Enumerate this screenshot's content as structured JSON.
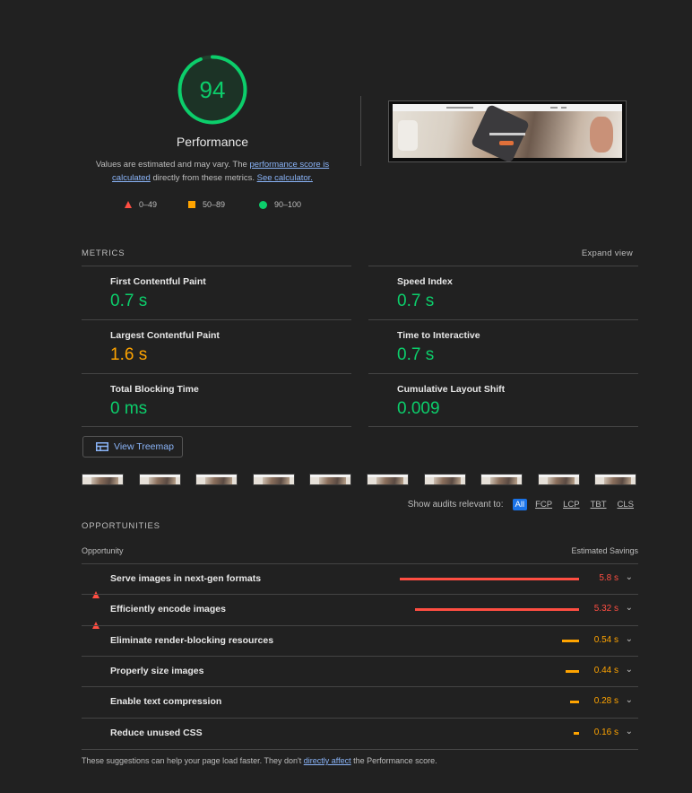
{
  "summary": {
    "score": "94",
    "score_color": "#0cce6b",
    "score_fraction": 0.94,
    "title": "Performance",
    "desc_prefix": "Values are estimated and may vary. The ",
    "desc_link1": "performance score is calculated",
    "desc_mid": " directly from these metrics. ",
    "desc_link2": "See calculator."
  },
  "legend": [
    {
      "icon": "fail-triangle",
      "range": "0–49"
    },
    {
      "icon": "average-square",
      "range": "50–89"
    },
    {
      "icon": "pass-circle",
      "range": "90–100"
    }
  ],
  "metrics_section": {
    "header": "METRICS",
    "expand": "Expand view"
  },
  "metrics": [
    {
      "name": "First Contentful Paint",
      "value": "0.7 s",
      "rating": "pass"
    },
    {
      "name": "Speed Index",
      "value": "0.7 s",
      "rating": "pass"
    },
    {
      "name": "Largest Contentful Paint",
      "value": "1.6 s",
      "rating": "average"
    },
    {
      "name": "Time to Interactive",
      "value": "0.7 s",
      "rating": "pass"
    },
    {
      "name": "Total Blocking Time",
      "value": "0 ms",
      "rating": "pass"
    },
    {
      "name": "Cumulative Layout Shift",
      "value": "0.009",
      "rating": "pass"
    }
  ],
  "treemap": {
    "label": "View Treemap",
    "icon": "treemap-icon"
  },
  "filter": {
    "label": "Show audits relevant to:",
    "chips": [
      "All",
      "FCP",
      "LCP",
      "TBT",
      "CLS"
    ],
    "active": "All"
  },
  "opportunities": {
    "header": "OPPORTUNITIES",
    "col_opportunity": "Opportunity",
    "col_savings": "Estimated Savings",
    "items": [
      {
        "title": "Serve images in next-gen formats",
        "savings": "5.8 s",
        "seconds": 5.8,
        "rating": "fail"
      },
      {
        "title": "Efficiently encode images",
        "savings": "5.32 s",
        "seconds": 5.32,
        "rating": "fail"
      },
      {
        "title": "Eliminate render-blocking resources",
        "savings": "0.54 s",
        "seconds": 0.54,
        "rating": "average"
      },
      {
        "title": "Properly size images",
        "savings": "0.44 s",
        "seconds": 0.44,
        "rating": "average"
      },
      {
        "title": "Enable text compression",
        "savings": "0.28 s",
        "seconds": 0.28,
        "rating": "average"
      },
      {
        "title": "Reduce unused CSS",
        "savings": "0.16 s",
        "seconds": 0.16,
        "rating": "average"
      }
    ]
  },
  "footer": {
    "prefix": "These suggestions can help your page load faster. They don't ",
    "link": "directly affect",
    "suffix": " the Performance score."
  },
  "colors": {
    "pass": "#0cce6b",
    "average": "#ffa400",
    "fail": "#ff4e42",
    "accent": "#8ab4f8"
  }
}
